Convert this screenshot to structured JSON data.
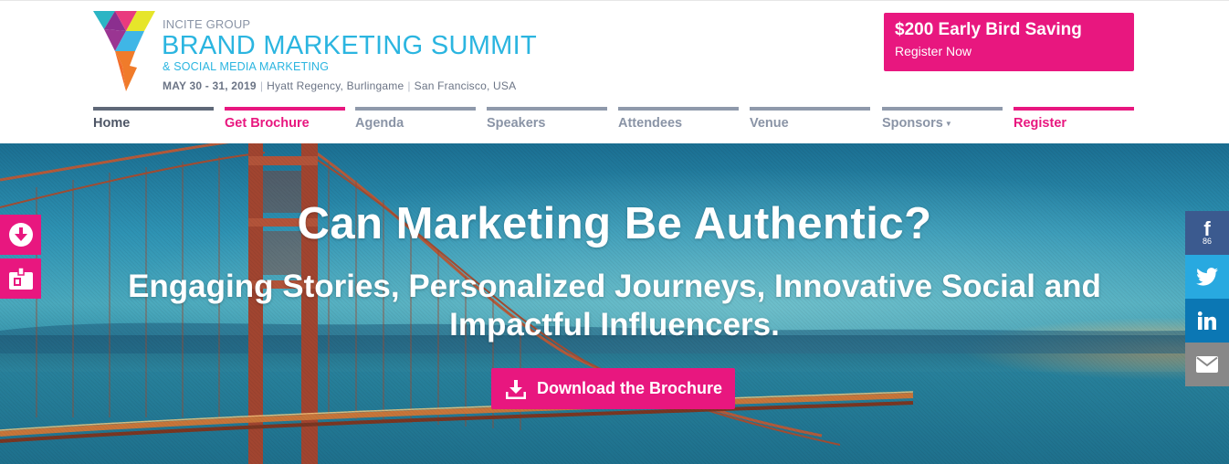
{
  "colors": {
    "brand_pink": "#e8177f",
    "brand_cyan": "#2bb5e0",
    "nav_gray": "#8a94a6",
    "facebook": "#3b5a8f",
    "twitter": "#28a9e0",
    "linkedin": "#0b77b4",
    "email": "#888888"
  },
  "brand": {
    "pre": "INCITE GROUP",
    "title": "BRAND MARKETING SUMMIT",
    "sub": "& SOCIAL MEDIA MARKETING",
    "date": "MAY 30 - 31, 2019",
    "venue": "Hyatt Regency, Burlingame",
    "city": "San Francisco, USA",
    "separator": "|"
  },
  "early_bird": {
    "title": "$200 Early Bird Saving",
    "sub": "Register Now"
  },
  "nav": {
    "home": "Home",
    "brochure": "Get Brochure",
    "agenda": "Agenda",
    "speakers": "Speakers",
    "attendees": "Attendees",
    "venue": "Venue",
    "sponsors": "Sponsors",
    "register": "Register"
  },
  "hero": {
    "headline": "Can Marketing Be Authentic?",
    "subheadline": "Engaging Stories, Personalized Journeys, Innovative Social and Impactful Influencers.",
    "cta_label": "Download the Brochure"
  },
  "side_left": {
    "icons": [
      "download-icon",
      "badge-icon"
    ]
  },
  "share": {
    "facebook_icon": "f",
    "facebook_count": "86",
    "icons": [
      "facebook-icon",
      "twitter-icon",
      "linkedin-icon",
      "email-icon"
    ]
  }
}
